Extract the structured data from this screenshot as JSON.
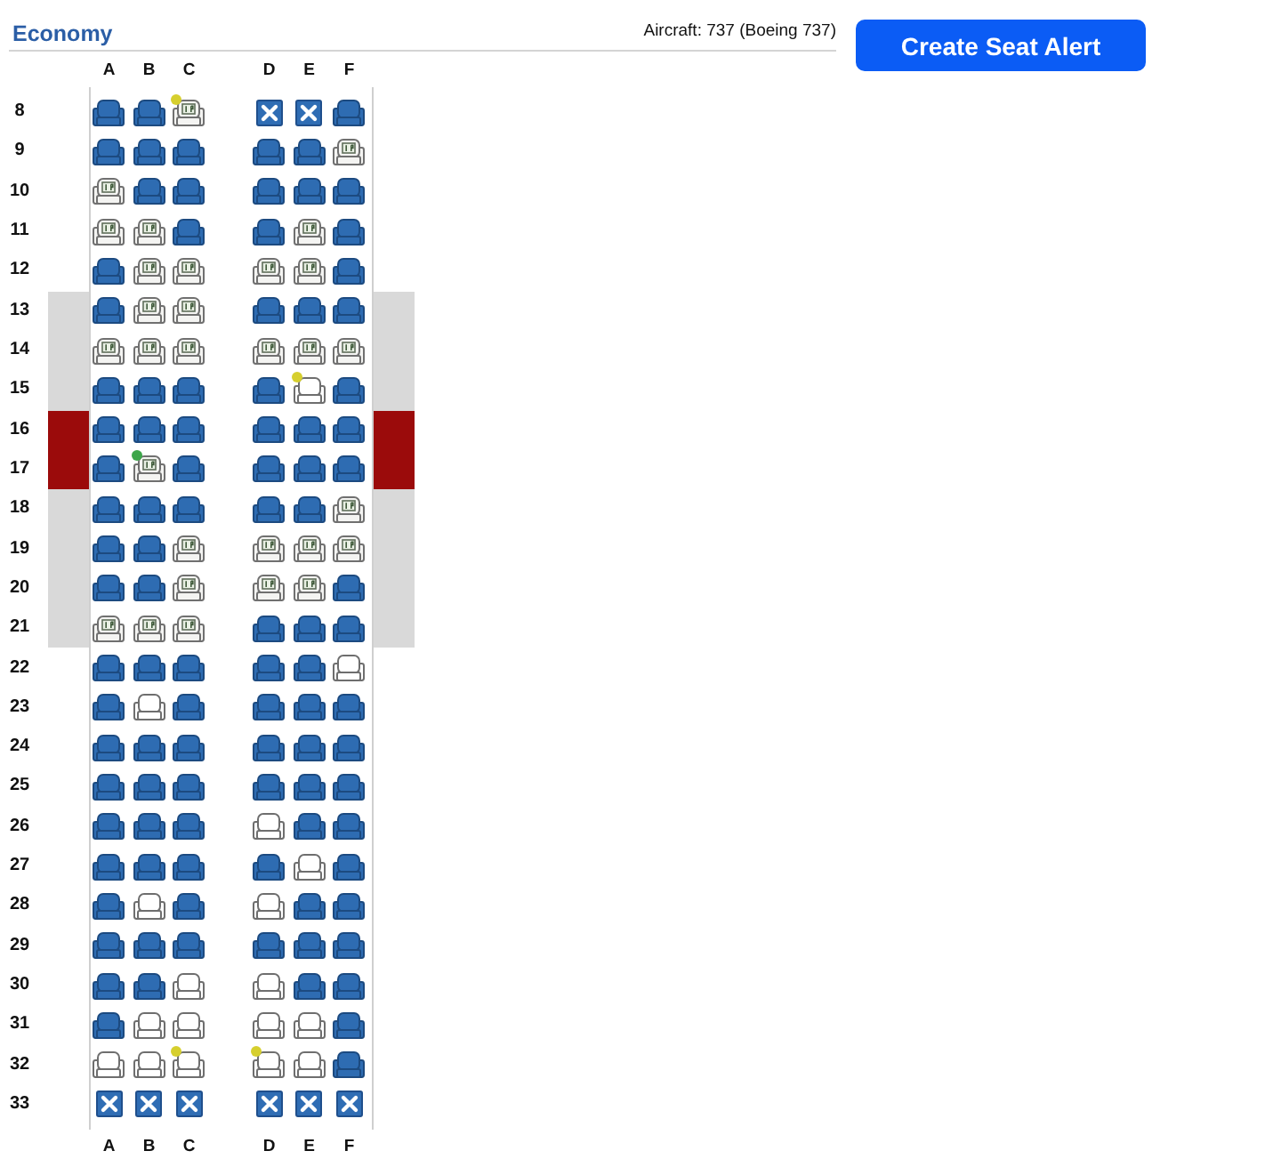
{
  "cabin": {
    "title": "Economy",
    "aircraft": "Aircraft: 737 (Boeing 737)"
  },
  "alert_button": {
    "label": "Create Seat Alert"
  },
  "column_labels_top": [
    "A",
    "B",
    "C",
    "D",
    "E",
    "F"
  ],
  "rows": [
    {
      "number": "8",
      "over_wing": false,
      "exit": false,
      "seats": [
        {
          "kind": "occupied"
        },
        {
          "kind": "occupied"
        },
        {
          "kind": "preferred",
          "dot": {
            "color": "#d6cf2e"
          }
        },
        {
          "kind": "blocked"
        },
        {
          "kind": "blocked"
        },
        {
          "kind": "occupied"
        }
      ]
    },
    {
      "number": "9",
      "over_wing": false,
      "exit": false,
      "seats": [
        {
          "kind": "occupied"
        },
        {
          "kind": "occupied"
        },
        {
          "kind": "occupied"
        },
        {
          "kind": "occupied"
        },
        {
          "kind": "occupied"
        },
        {
          "kind": "preferred"
        }
      ]
    },
    {
      "number": "10",
      "over_wing": false,
      "exit": false,
      "seats": [
        {
          "kind": "preferred"
        },
        {
          "kind": "occupied"
        },
        {
          "kind": "occupied"
        },
        {
          "kind": "occupied"
        },
        {
          "kind": "occupied"
        },
        {
          "kind": "occupied"
        }
      ]
    },
    {
      "number": "11",
      "over_wing": false,
      "exit": false,
      "seats": [
        {
          "kind": "preferred"
        },
        {
          "kind": "preferred"
        },
        {
          "kind": "occupied"
        },
        {
          "kind": "occupied"
        },
        {
          "kind": "preferred"
        },
        {
          "kind": "occupied"
        }
      ]
    },
    {
      "number": "12",
      "over_wing": false,
      "exit": false,
      "seats": [
        {
          "kind": "occupied"
        },
        {
          "kind": "preferred"
        },
        {
          "kind": "preferred"
        },
        {
          "kind": "preferred"
        },
        {
          "kind": "preferred"
        },
        {
          "kind": "occupied"
        }
      ]
    },
    {
      "number": "13",
      "over_wing": true,
      "exit": false,
      "seats": [
        {
          "kind": "occupied"
        },
        {
          "kind": "preferred"
        },
        {
          "kind": "preferred"
        },
        {
          "kind": "occupied"
        },
        {
          "kind": "occupied"
        },
        {
          "kind": "occupied"
        }
      ]
    },
    {
      "number": "14",
      "over_wing": true,
      "exit": false,
      "seats": [
        {
          "kind": "preferred"
        },
        {
          "kind": "preferred"
        },
        {
          "kind": "preferred"
        },
        {
          "kind": "preferred"
        },
        {
          "kind": "preferred"
        },
        {
          "kind": "preferred"
        }
      ]
    },
    {
      "number": "15",
      "over_wing": true,
      "exit": false,
      "seats": [
        {
          "kind": "occupied"
        },
        {
          "kind": "occupied"
        },
        {
          "kind": "occupied"
        },
        {
          "kind": "occupied"
        },
        {
          "kind": "available",
          "dot": {
            "color": "#d6cf2e"
          }
        },
        {
          "kind": "occupied"
        }
      ]
    },
    {
      "number": "16",
      "over_wing": false,
      "exit": true,
      "seats": [
        {
          "kind": "occupied"
        },
        {
          "kind": "occupied"
        },
        {
          "kind": "occupied"
        },
        {
          "kind": "occupied"
        },
        {
          "kind": "occupied"
        },
        {
          "kind": "occupied"
        }
      ]
    },
    {
      "number": "17",
      "over_wing": false,
      "exit": true,
      "seats": [
        {
          "kind": "occupied"
        },
        {
          "kind": "preferred",
          "dot": {
            "color": "#3da64a"
          }
        },
        {
          "kind": "occupied"
        },
        {
          "kind": "occupied"
        },
        {
          "kind": "occupied"
        },
        {
          "kind": "occupied"
        }
      ]
    },
    {
      "number": "18",
      "over_wing": true,
      "exit": false,
      "seats": [
        {
          "kind": "occupied"
        },
        {
          "kind": "occupied"
        },
        {
          "kind": "occupied"
        },
        {
          "kind": "occupied"
        },
        {
          "kind": "occupied"
        },
        {
          "kind": "preferred"
        }
      ]
    },
    {
      "number": "19",
      "over_wing": true,
      "exit": false,
      "seats": [
        {
          "kind": "occupied"
        },
        {
          "kind": "occupied"
        },
        {
          "kind": "preferred"
        },
        {
          "kind": "preferred"
        },
        {
          "kind": "preferred"
        },
        {
          "kind": "preferred"
        }
      ]
    },
    {
      "number": "20",
      "over_wing": true,
      "exit": false,
      "seats": [
        {
          "kind": "occupied"
        },
        {
          "kind": "occupied"
        },
        {
          "kind": "preferred"
        },
        {
          "kind": "preferred"
        },
        {
          "kind": "preferred"
        },
        {
          "kind": "occupied"
        }
      ]
    },
    {
      "number": "21",
      "over_wing": true,
      "exit": false,
      "seats": [
        {
          "kind": "preferred"
        },
        {
          "kind": "preferred"
        },
        {
          "kind": "preferred"
        },
        {
          "kind": "occupied"
        },
        {
          "kind": "occupied"
        },
        {
          "kind": "occupied"
        }
      ]
    },
    {
      "number": "22",
      "over_wing": false,
      "exit": false,
      "seats": [
        {
          "kind": "occupied"
        },
        {
          "kind": "occupied"
        },
        {
          "kind": "occupied"
        },
        {
          "kind": "occupied"
        },
        {
          "kind": "occupied"
        },
        {
          "kind": "available"
        }
      ]
    },
    {
      "number": "23",
      "over_wing": false,
      "exit": false,
      "seats": [
        {
          "kind": "occupied"
        },
        {
          "kind": "available"
        },
        {
          "kind": "occupied"
        },
        {
          "kind": "occupied"
        },
        {
          "kind": "occupied"
        },
        {
          "kind": "occupied"
        }
      ]
    },
    {
      "number": "24",
      "over_wing": false,
      "exit": false,
      "seats": [
        {
          "kind": "occupied"
        },
        {
          "kind": "occupied"
        },
        {
          "kind": "occupied"
        },
        {
          "kind": "occupied"
        },
        {
          "kind": "occupied"
        },
        {
          "kind": "occupied"
        }
      ]
    },
    {
      "number": "25",
      "over_wing": false,
      "exit": false,
      "seats": [
        {
          "kind": "occupied"
        },
        {
          "kind": "occupied"
        },
        {
          "kind": "occupied"
        },
        {
          "kind": "occupied"
        },
        {
          "kind": "occupied"
        },
        {
          "kind": "occupied"
        }
      ]
    },
    {
      "number": "26",
      "over_wing": false,
      "exit": false,
      "seats": [
        {
          "kind": "occupied"
        },
        {
          "kind": "occupied"
        },
        {
          "kind": "occupied"
        },
        {
          "kind": "available"
        },
        {
          "kind": "occupied"
        },
        {
          "kind": "occupied"
        }
      ]
    },
    {
      "number": "27",
      "over_wing": false,
      "exit": false,
      "seats": [
        {
          "kind": "occupied"
        },
        {
          "kind": "occupied"
        },
        {
          "kind": "occupied"
        },
        {
          "kind": "occupied"
        },
        {
          "kind": "available"
        },
        {
          "kind": "occupied"
        }
      ]
    },
    {
      "number": "28",
      "over_wing": false,
      "exit": false,
      "seats": [
        {
          "kind": "occupied"
        },
        {
          "kind": "available"
        },
        {
          "kind": "occupied"
        },
        {
          "kind": "available"
        },
        {
          "kind": "occupied"
        },
        {
          "kind": "occupied"
        }
      ]
    },
    {
      "number": "29",
      "over_wing": false,
      "exit": false,
      "seats": [
        {
          "kind": "occupied"
        },
        {
          "kind": "occupied"
        },
        {
          "kind": "occupied"
        },
        {
          "kind": "occupied"
        },
        {
          "kind": "occupied"
        },
        {
          "kind": "occupied"
        }
      ]
    },
    {
      "number": "30",
      "over_wing": false,
      "exit": false,
      "seats": [
        {
          "kind": "occupied"
        },
        {
          "kind": "occupied"
        },
        {
          "kind": "available"
        },
        {
          "kind": "available"
        },
        {
          "kind": "occupied"
        },
        {
          "kind": "occupied"
        }
      ]
    },
    {
      "number": "31",
      "over_wing": false,
      "exit": false,
      "seats": [
        {
          "kind": "occupied"
        },
        {
          "kind": "available"
        },
        {
          "kind": "available"
        },
        {
          "kind": "available"
        },
        {
          "kind": "available"
        },
        {
          "kind": "occupied"
        }
      ]
    },
    {
      "number": "32",
      "over_wing": false,
      "exit": false,
      "seats": [
        {
          "kind": "available"
        },
        {
          "kind": "available"
        },
        {
          "kind": "available",
          "dot": {
            "color": "#d6cf2e"
          }
        },
        {
          "kind": "available",
          "dot": {
            "color": "#d6cf2e"
          }
        },
        {
          "kind": "available"
        },
        {
          "kind": "occupied"
        }
      ]
    },
    {
      "number": "33",
      "over_wing": false,
      "exit": false,
      "seats": [
        {
          "kind": "blocked"
        },
        {
          "kind": "blocked"
        },
        {
          "kind": "blocked"
        },
        {
          "kind": "blocked"
        },
        {
          "kind": "blocked"
        },
        {
          "kind": "blocked"
        }
      ]
    }
  ],
  "column_labels_bottom": [
    "A",
    "B",
    "C",
    "D",
    "E",
    "F"
  ]
}
